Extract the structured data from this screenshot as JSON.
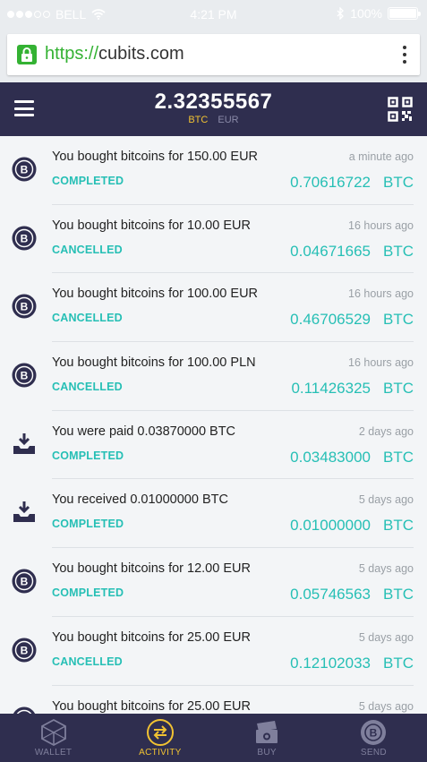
{
  "status_bar": {
    "carrier": "BELL",
    "time": "4:21 PM",
    "battery": "100%",
    "battery_level": 1.0
  },
  "browser": {
    "url_scheme": "https://",
    "url_host": "cubits.com"
  },
  "header": {
    "balance": "2.32355567",
    "currency_active": "BTC",
    "currency_other": "EUR",
    "accent_color": "#f1c232",
    "background_color": "#2f2e4f"
  },
  "activity": [
    {
      "icon": "bitcoin-icon",
      "title": "You bought bitcoins for 150.00 EUR",
      "time": "a minute ago",
      "status": "COMPLETED",
      "amount": "0.70616722",
      "currency": "BTC"
    },
    {
      "icon": "bitcoin-icon",
      "title": "You bought bitcoins for 10.00 EUR",
      "time": "16 hours ago",
      "status": "CANCELLED",
      "amount": "0.04671665",
      "currency": "BTC"
    },
    {
      "icon": "bitcoin-icon",
      "title": "You bought bitcoins for 100.00 EUR",
      "time": "16 hours ago",
      "status": "CANCELLED",
      "amount": "0.46706529",
      "currency": "BTC"
    },
    {
      "icon": "bitcoin-icon",
      "title": "You bought bitcoins for 100.00 PLN",
      "time": "16 hours ago",
      "status": "CANCELLED",
      "amount": "0.11426325",
      "currency": "BTC"
    },
    {
      "icon": "receive-icon",
      "title": "You were paid 0.03870000 BTC",
      "time": "2 days ago",
      "status": "COMPLETED",
      "amount": "0.03483000",
      "currency": "BTC"
    },
    {
      "icon": "receive-icon",
      "title": "You received 0.01000000 BTC",
      "time": "5 days ago",
      "status": "COMPLETED",
      "amount": "0.01000000",
      "currency": "BTC"
    },
    {
      "icon": "bitcoin-icon",
      "title": "You bought bitcoins for 12.00 EUR",
      "time": "5 days ago",
      "status": "COMPLETED",
      "amount": "0.05746563",
      "currency": "BTC"
    },
    {
      "icon": "bitcoin-icon",
      "title": "You bought bitcoins for 25.00 EUR",
      "time": "5 days ago",
      "status": "CANCELLED",
      "amount": "0.12102033",
      "currency": "BTC"
    },
    {
      "icon": "bitcoin-icon",
      "title": "You bought bitcoins for 25.00 EUR",
      "time": "5 days ago",
      "status": "",
      "amount": "",
      "currency": ""
    }
  ],
  "status_color": "#26bfb5",
  "bottom_nav": [
    {
      "label": "WALLET",
      "icon": "wallet-icon",
      "active": false
    },
    {
      "label": "ACTIVITY",
      "icon": "activity-icon",
      "active": true
    },
    {
      "label": "BUY",
      "icon": "buy-icon",
      "active": false
    },
    {
      "label": "SEND",
      "icon": "send-icon",
      "active": false
    }
  ]
}
